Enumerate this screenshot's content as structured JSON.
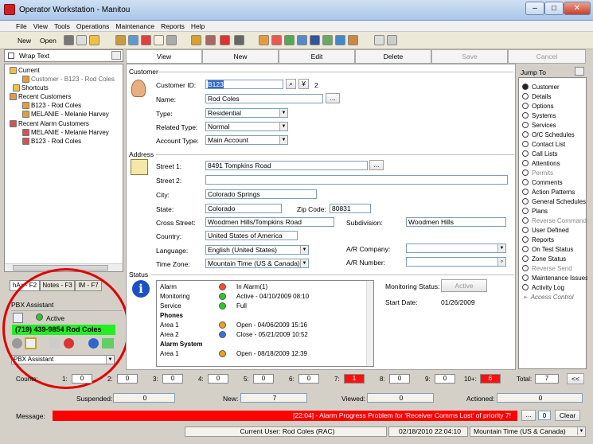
{
  "window": {
    "title": "Operator Workstation - Manitou",
    "minimize": "–",
    "maximize": "□",
    "close": "✕"
  },
  "menu": [
    "File",
    "View",
    "Tools",
    "Operations",
    "Maintenance",
    "Reports",
    "Help"
  ],
  "toolbar": {
    "new_label": "New",
    "open_label": "Open"
  },
  "left": {
    "wrap_text": "Wrap Text",
    "tree": {
      "current": "Current",
      "current_customer": "Customer - B123 - Rod Coles",
      "shortcuts": "Shortcuts",
      "recent_customers": "Recent Customers",
      "rc1": "B123 - Rod Coles",
      "rc2": "MELANIE - Melanie Harvey",
      "recent_alarm": "Recent Alarm Customers",
      "ra1": "MELANIE - Melanie Harvey",
      "ra2": "B123 - Rod Coles"
    },
    "tabs": [
      "hAx - F2",
      "Notes - F3",
      "IM - F7"
    ],
    "pbx": {
      "title": "PBX Assistant",
      "status": "Active",
      "phone": "(719) 439-9854 Rod Coles",
      "select": "PBX Assistant"
    }
  },
  "actions": {
    "view": "View",
    "new": "New",
    "edit": "Edit",
    "delete": "Delete",
    "save": "Save",
    "cancel": "Cancel"
  },
  "customer": {
    "section": "Customer",
    "id_label": "Customer ID:",
    "id_value": "B123",
    "id_count": "2",
    "name_label": "Name:",
    "name_value": "Rod Coles",
    "ellipsis": "...",
    "type_label": "Type:",
    "type_value": "Residential",
    "related_label": "Related Type:",
    "related_value": "Normal",
    "account_label": "Account Type:",
    "account_value": "Main Account"
  },
  "address": {
    "section": "Address",
    "street1_label": "Street 1:",
    "street1_value": "8491 Tompkins Road",
    "street2_label": "Street 2:",
    "street2_value": "",
    "city_label": "City:",
    "city_value": "Colorado Springs",
    "state_label": "State:",
    "state_value": "Colorado",
    "zip_label": "Zip Code:",
    "zip_value": "80831",
    "cross_label": "Cross Street:",
    "cross_value": "Woodmen Hills/Tompkins Road",
    "subdiv_label": "Subdivision:",
    "subdiv_value": "Woodmen Hills",
    "country_label": "Country:",
    "country_value": "United States of America",
    "language_label": "Language:",
    "language_value": "English (United States)",
    "ar_company_label": "A/R Company:",
    "ar_company_value": "",
    "tz_label": "Time Zone:",
    "tz_value": "Mountain Time (US & Canada)",
    "ar_number_label": "A/R Number:",
    "ar_number_value": ""
  },
  "status": {
    "section": "Status",
    "rows": [
      {
        "name": "Alarm",
        "value": "In Alarm(1)",
        "color": "#ff4a2a"
      },
      {
        "name": "Monitoring",
        "value": "Active - 04/10/2009 08:10",
        "color": "#2ec82e"
      },
      {
        "name": "Service",
        "value": "Full",
        "color": "#2ec82e"
      }
    ],
    "phones_header": "Phones",
    "phones": [
      {
        "name": "Area 1",
        "value": "Open - 04/06/2009 15:16",
        "color": "#f0a020"
      },
      {
        "name": "Area 2",
        "value": "Close - 05/21/2009 10:52",
        "color": "#3a70e0"
      }
    ],
    "alarm_header": "Alarm System",
    "alarm": [
      {
        "name": "Area 1",
        "value": "Open - 08/18/2009 12:39",
        "color": "#f0a020"
      }
    ],
    "monitoring_label": "Monitoring Status:",
    "monitoring_value": "Active",
    "start_label": "Start Date:",
    "start_value": "01/26/2009"
  },
  "jump": {
    "title": "Jump To",
    "items": [
      "Customer",
      "Details",
      "Options",
      "Systems",
      "Services",
      "O/C Schedules",
      "Contact List",
      "Call Lists",
      "Attentions",
      "Permits",
      "Comments",
      "Action Patterns",
      "General Schedules",
      "Plans",
      "Reverse Commands",
      "User Defined",
      "Reports",
      "On Test Status",
      "Zone Status",
      "Reverse Send",
      "Maintenance Issues",
      "Activity Log",
      "Access Control"
    ]
  },
  "counts": {
    "label": "Counts:",
    "items": [
      {
        "label": "1:",
        "value": "0"
      },
      {
        "label": "2:",
        "value": "0"
      },
      {
        "label": "3:",
        "value": "0"
      },
      {
        "label": "4:",
        "value": "0"
      },
      {
        "label": "5:",
        "value": "0"
      },
      {
        "label": "6:",
        "value": "0"
      },
      {
        "label": "7:",
        "value": "1"
      },
      {
        "label": "8:",
        "value": "0"
      },
      {
        "label": "9:",
        "value": "0"
      },
      {
        "label": "10+:",
        "value": "6"
      }
    ],
    "total_label": "Total:",
    "total_value": "7",
    "collapse": "<<",
    "suspended_label": "Suspended:",
    "suspended_value": "0",
    "new_label": "New:",
    "new_value": "7",
    "viewed_label": "Viewed:",
    "viewed_value": "0",
    "actioned_label": "Actioned:",
    "actioned_value": "0",
    "alert_color": "#ff1010"
  },
  "message": {
    "label": "Message:",
    "text": "[22:04] - Alarm Progress Problem for 'Receiver Comms Lost' of priority 7!",
    "ellipsis": "...",
    "count": "0",
    "clear": "Clear"
  },
  "statusbar": {
    "user": "Current User:  Rod Coles (RAC)",
    "datetime": "02/18/2010 22:04:10",
    "tz": "Mountain Time (US & Canada)"
  }
}
